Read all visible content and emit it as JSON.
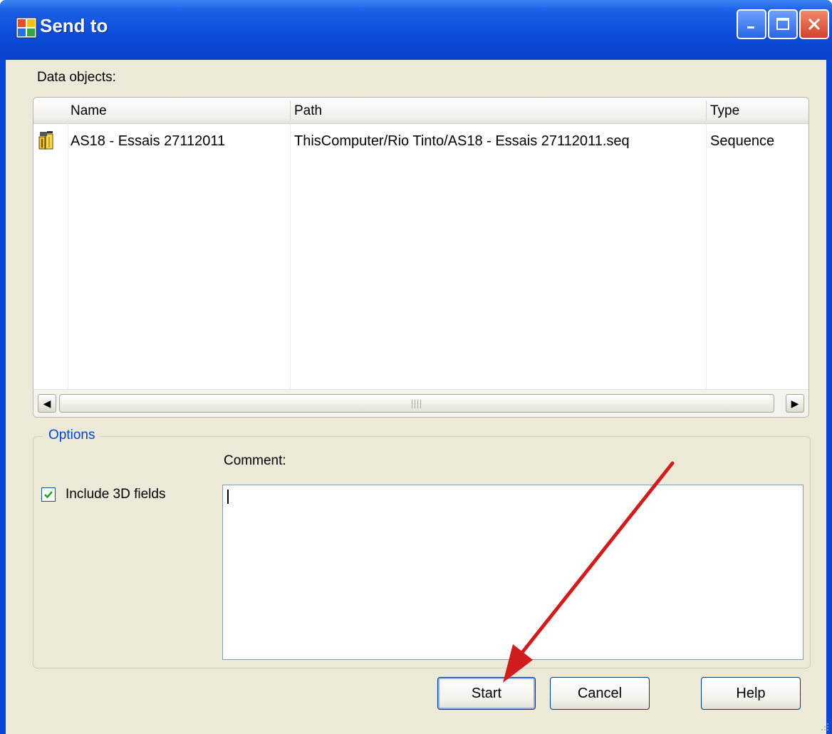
{
  "window": {
    "title": "Send to",
    "title_buttons": [
      "minimize",
      "maximize",
      "close"
    ]
  },
  "data_objects_label": "Data objects:",
  "listview": {
    "columns": [
      "Name",
      "Path",
      "Type"
    ],
    "rows": [
      {
        "icon": "sequence-icon",
        "name": "AS18 - Essais 27112011",
        "path": "ThisComputer/Rio Tinto/AS18 - Essais 27112011.seq",
        "type": "Sequence"
      }
    ]
  },
  "options": {
    "group_title": "Options",
    "include_3d_label": "Include 3D fields",
    "include_3d_checked": true,
    "comment_label": "Comment:",
    "comment_value": ""
  },
  "buttons": {
    "start": "Start",
    "cancel": "Cancel",
    "help": "Help"
  },
  "colors": {
    "titlebar": "#0a47d6",
    "client_bg": "#ece9d8",
    "group_title": "#0046d5",
    "arrow": "#d01c1c"
  }
}
